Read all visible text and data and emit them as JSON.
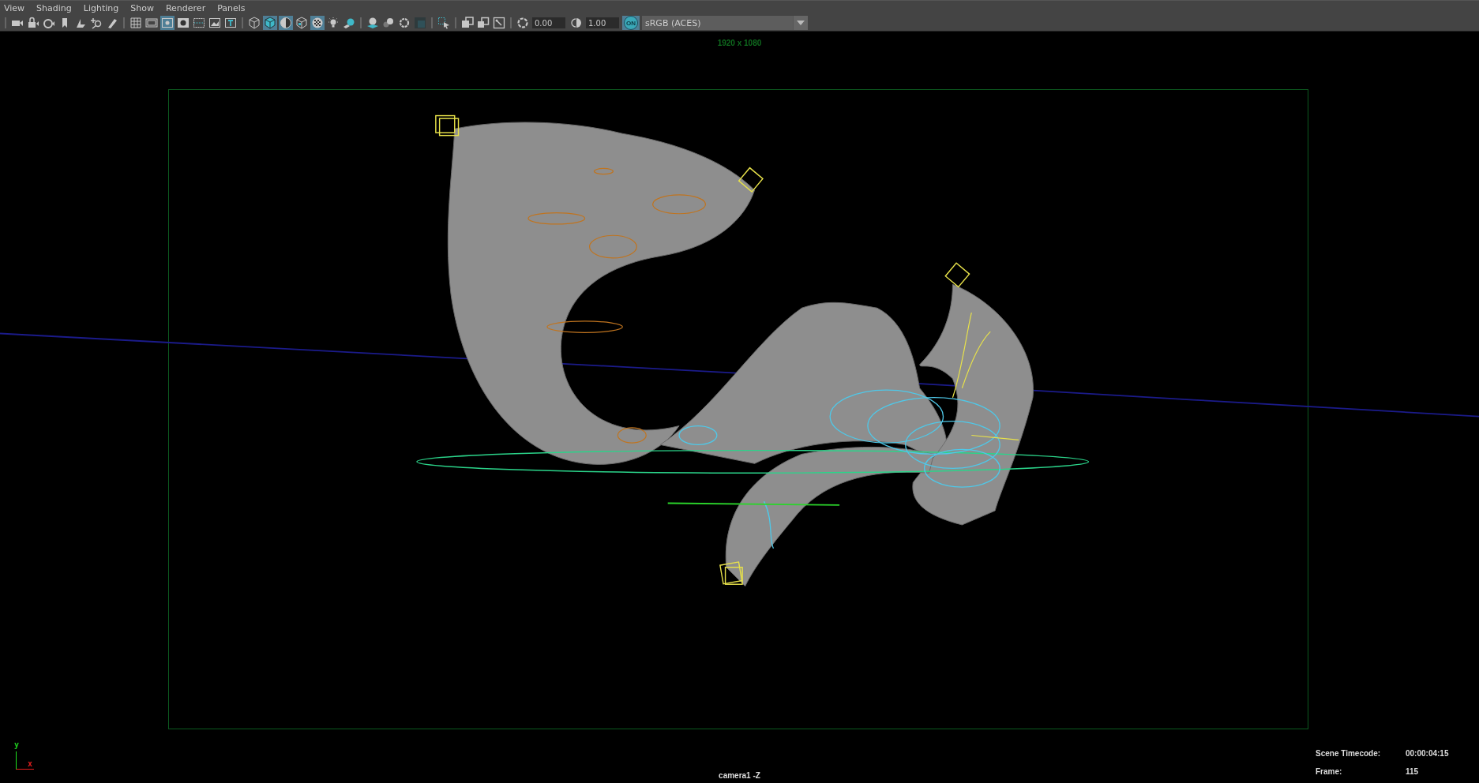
{
  "menu": [
    "View",
    "Shading",
    "Lighting",
    "Show",
    "Renderer",
    "Panels"
  ],
  "toolbar": [
    {
      "kind": "camera",
      "selected": false
    },
    {
      "kind": "camera-lock",
      "selected": false
    },
    {
      "kind": "camera-attributes",
      "selected": false
    },
    {
      "kind": "bookmark",
      "selected": false
    },
    {
      "kind": "image-plane",
      "selected": false
    },
    {
      "kind": "zoom",
      "selected": false
    },
    {
      "kind": "pencil",
      "selected": false
    },
    {
      "kind": "separator"
    },
    {
      "kind": "grid",
      "selected": false
    },
    {
      "kind": "film-gate",
      "selected": false
    },
    {
      "kind": "resolution-gate",
      "selected": true
    },
    {
      "kind": "gate-mask",
      "selected": false
    },
    {
      "kind": "field-chart",
      "selected": false
    },
    {
      "kind": "safe-action",
      "selected": false
    },
    {
      "kind": "safe-title",
      "selected": false
    },
    {
      "kind": "separator"
    },
    {
      "kind": "wireframe",
      "selected": false
    },
    {
      "kind": "smooth-shade",
      "selected": true
    },
    {
      "kind": "wire-on-shaded",
      "selected": true
    },
    {
      "kind": "default-material",
      "selected": false
    },
    {
      "kind": "textured",
      "selected": true
    },
    {
      "kind": "lights",
      "selected": false
    },
    {
      "kind": "shadows",
      "selected": false
    },
    {
      "kind": "separator"
    },
    {
      "kind": "ambient-occlusion",
      "selected": false
    },
    {
      "kind": "motion-blur",
      "selected": false
    },
    {
      "kind": "anti-alias",
      "selected": false
    },
    {
      "kind": "depth-of-field",
      "selected": false
    },
    {
      "kind": "separator"
    },
    {
      "kind": "select-camera",
      "selected": false
    },
    {
      "kind": "separator"
    },
    {
      "kind": "isolate",
      "selected": false
    },
    {
      "kind": "xray",
      "selected": false
    },
    {
      "kind": "xray-joints",
      "selected": false
    },
    {
      "kind": "separator"
    }
  ],
  "exposure": {
    "value": "0.00"
  },
  "gamma": {
    "value": "1.00"
  },
  "color_management": {
    "label": "ON",
    "selected": true
  },
  "view_transform": {
    "value": "sRGB (ACES)"
  },
  "viewport": {
    "resolution": "1920 x 1080",
    "camera": "camera1 -Z",
    "axis": {
      "y": "y",
      "x": "x"
    },
    "hud": [
      {
        "label": "Scene Timecode:",
        "value": "00:00:04:15"
      },
      {
        "label": "Frame:",
        "value": "115"
      }
    ]
  }
}
